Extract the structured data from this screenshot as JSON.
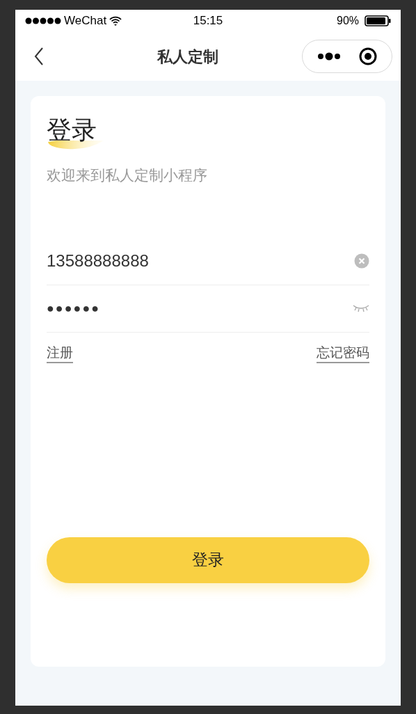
{
  "status_bar": {
    "carrier": "WeChat",
    "time": "15:15",
    "battery": "90%"
  },
  "nav": {
    "title": "私人定制"
  },
  "card": {
    "title": "登录",
    "subtitle": "欢迎来到私人定制小程序",
    "phone_field": {
      "value": "13588888888"
    },
    "password_field": {
      "value": "●●●●●●"
    },
    "links": [
      "注册",
      "忘记密码"
    ],
    "login_button": "登录"
  }
}
